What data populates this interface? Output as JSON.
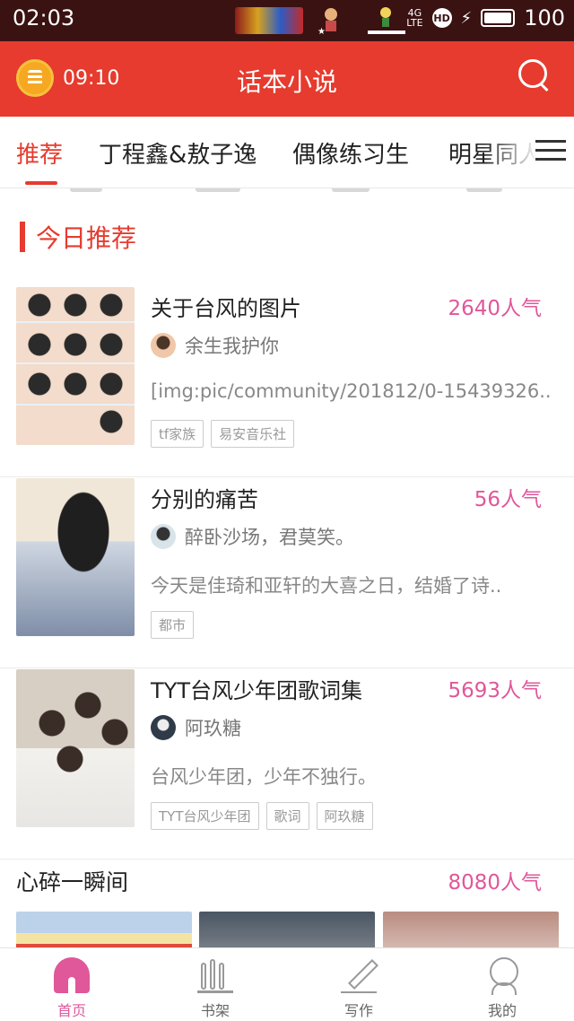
{
  "status_bar": {
    "time": "02:03",
    "network": "4G",
    "network_sub": "LTE",
    "hd": "HD",
    "battery": "100"
  },
  "header": {
    "timer": "09:10",
    "title": "话本小说"
  },
  "tabs": [
    "推荐",
    "丁程鑫&敖子逸",
    "偶像练习生",
    "明星同人"
  ],
  "section": {
    "title": "今日推荐"
  },
  "books": [
    {
      "title": "关于台风的图片",
      "popularity": "2640人气",
      "author": "余生我护你",
      "description": "[img:pic/community/201812/0-15439326..",
      "tags": [
        "tf家族",
        "易安音乐社"
      ]
    },
    {
      "title": "分别的痛苦",
      "popularity": "56人气",
      "author": "醉卧沙场，君莫笑。",
      "description": "今天是佳琦和亚轩的大喜之日，结婚了诗..",
      "tags": [
        "都市"
      ]
    },
    {
      "title": "TYT台风少年团歌词集",
      "popularity": "5693人气",
      "author": "阿玖糖",
      "description": "台风少年团，少年不独行。",
      "tags": [
        "TYT台风少年团",
        "歌词",
        "阿玖糖"
      ]
    }
  ],
  "feature": {
    "title": "心碎一瞬间",
    "popularity": "8080人气"
  },
  "bottom_nav": [
    "首页",
    "书架",
    "写作",
    "我的"
  ],
  "colors": {
    "accent": "#e63b2e",
    "popularity": "#e0579a",
    "status_bar": "#3a1212"
  }
}
